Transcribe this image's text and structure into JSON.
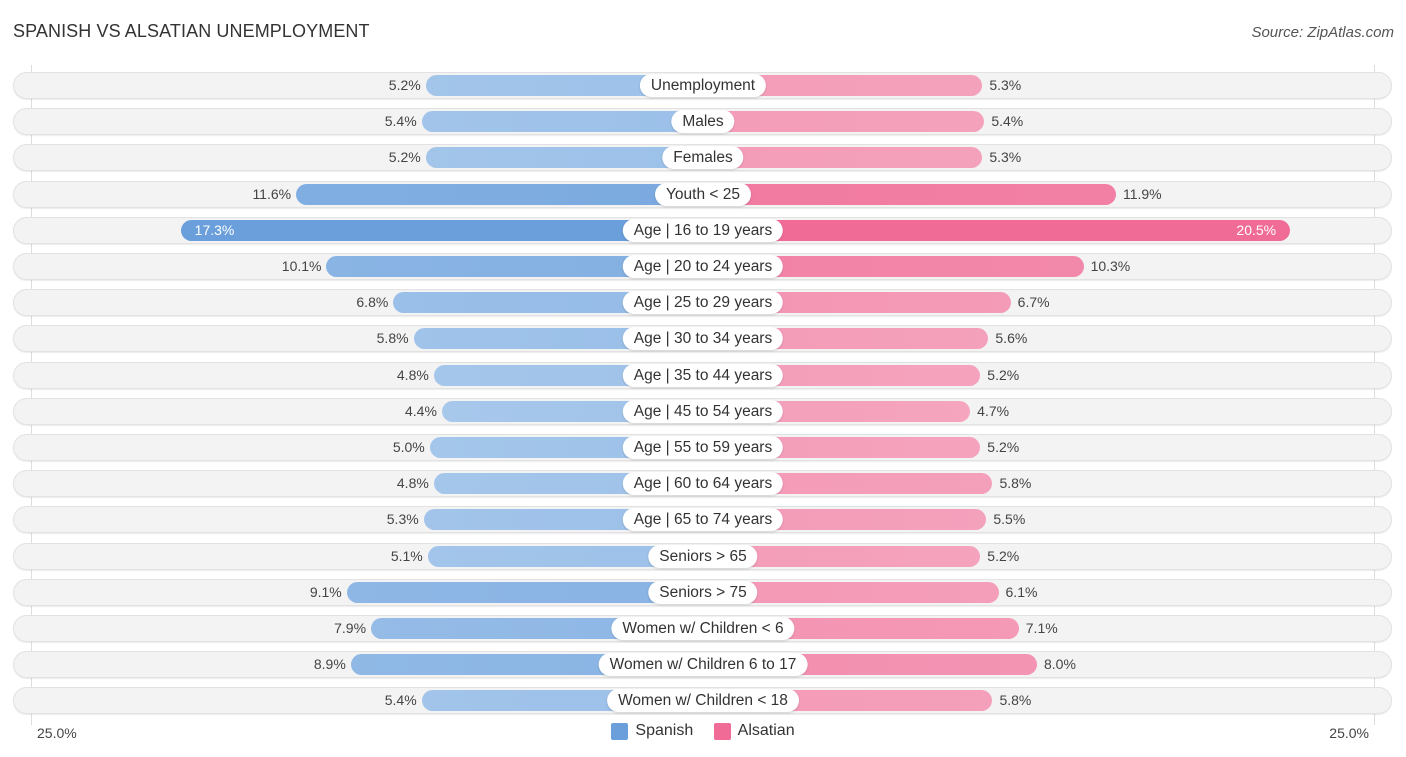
{
  "header": {
    "title": "SPANISH VS ALSATIAN UNEMPLOYMENT",
    "source": "Source: ZipAtlas.com"
  },
  "colors": {
    "spanish_strong": "#6a9fdc",
    "spanish_light": "#a9c9ec",
    "alsatian_strong": "#f06b96",
    "alsatian_light": "#f5a9c1"
  },
  "chart_data": {
    "type": "bar",
    "orientation": "horizontal-diverging",
    "title": "SPANISH VS ALSATIAN UNEMPLOYMENT",
    "categories": [
      "Unemployment",
      "Males",
      "Females",
      "Youth < 25",
      "Age | 16 to 19 years",
      "Age | 20 to 24 years",
      "Age | 25 to 29 years",
      "Age | 30 to 34 years",
      "Age | 35 to 44 years",
      "Age | 45 to 54 years",
      "Age | 55 to 59 years",
      "Age | 60 to 64 years",
      "Age | 65 to 74 years",
      "Seniors > 65",
      "Seniors > 75",
      "Women w/ Children < 6",
      "Women w/ Children 6 to 17",
      "Women w/ Children < 18"
    ],
    "series": [
      {
        "name": "Spanish",
        "side": "left",
        "values": [
          5.2,
          5.4,
          5.2,
          11.6,
          17.3,
          10.1,
          6.8,
          5.8,
          4.8,
          4.4,
          5.0,
          4.8,
          5.3,
          5.1,
          9.1,
          7.9,
          8.9,
          5.4
        ],
        "labels": [
          "5.2%",
          "5.4%",
          "5.2%",
          "11.6%",
          "17.3%",
          "10.1%",
          "6.8%",
          "5.8%",
          "4.8%",
          "4.4%",
          "5.0%",
          "4.8%",
          "5.3%",
          "5.1%",
          "9.1%",
          "7.9%",
          "8.9%",
          "5.4%"
        ]
      },
      {
        "name": "Alsatian",
        "side": "right",
        "values": [
          5.3,
          5.4,
          5.3,
          11.9,
          20.5,
          10.3,
          6.7,
          5.6,
          5.2,
          4.7,
          5.2,
          5.8,
          5.5,
          5.2,
          6.1,
          7.1,
          8.0,
          5.8
        ],
        "labels": [
          "5.3%",
          "5.4%",
          "5.3%",
          "11.9%",
          "20.5%",
          "10.3%",
          "6.7%",
          "5.6%",
          "5.2%",
          "4.7%",
          "5.2%",
          "5.8%",
          "5.5%",
          "5.2%",
          "6.1%",
          "7.1%",
          "8.0%",
          "5.8%"
        ]
      }
    ],
    "axis": {
      "left_label": "25.0%",
      "right_label": "25.0%",
      "max": 25.0
    },
    "unit": "%",
    "legend": {
      "position": "bottom-center",
      "entries": [
        "Spanish",
        "Alsatian"
      ]
    },
    "grid": false
  }
}
